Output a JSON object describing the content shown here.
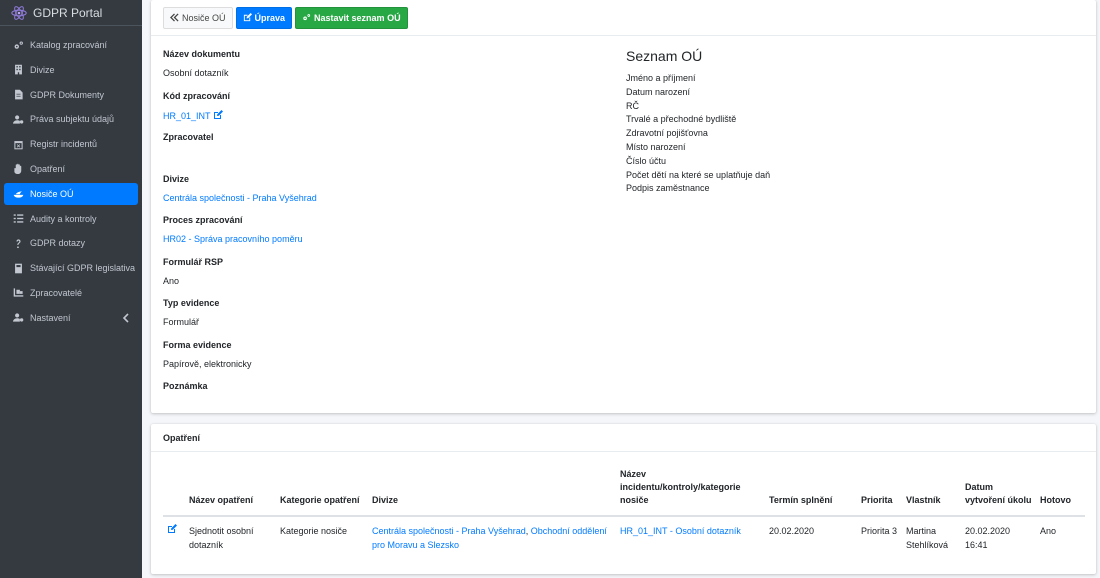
{
  "app": {
    "title": "GDPR Portal"
  },
  "sidebar": {
    "items": [
      {
        "label": "Katalog zpracování",
        "icon": "cogs-icon"
      },
      {
        "label": "Divize",
        "icon": "building-icon"
      },
      {
        "label": "GDPR Dokumenty",
        "icon": "file-icon"
      },
      {
        "label": "Práva subjektu údajů",
        "icon": "user-cog-icon"
      },
      {
        "label": "Registr incidentů",
        "icon": "calendar-x-icon"
      },
      {
        "label": "Opatření",
        "icon": "hand-icon"
      },
      {
        "label": "Nosiče OÚ",
        "icon": "sailboat-icon",
        "active": true
      },
      {
        "label": "Audity a kontroly",
        "icon": "tasks-icon"
      },
      {
        "label": "GDPR dotazy",
        "icon": "question-icon"
      },
      {
        "label": "Stávající GDPR legislativa",
        "icon": "book-icon"
      },
      {
        "label": "Zpracovatelé",
        "icon": "dolly-icon"
      },
      {
        "label": "Nastavení",
        "icon": "user-cog-icon",
        "has_caret": true
      }
    ]
  },
  "toolbar": {
    "back_label": "Nosiče OÚ",
    "edit_label": "Úprava",
    "set_list_label": "Nastavit seznam OÚ"
  },
  "document": {
    "fields": [
      {
        "label": "Název dokumentu",
        "value": "Osobní dotazník",
        "type": "text"
      },
      {
        "label": "Kód zpracování",
        "value": "HR_01_INT",
        "type": "link-edit"
      },
      {
        "label": "Zpracovatel",
        "value": "",
        "type": "text"
      },
      {
        "label": "Divize",
        "value": "Centrála společnosti - Praha Vyšehrad",
        "type": "link"
      },
      {
        "label": "Proces zpracování",
        "value": "HR02 - Správa pracovního poměru",
        "type": "link"
      },
      {
        "label": "Formulář RSP",
        "value": "Ano",
        "type": "text"
      },
      {
        "label": "Typ evidence",
        "value": "Formulář",
        "type": "text"
      },
      {
        "label": "Forma evidence",
        "value": "Papírově, elektronicky",
        "type": "text"
      },
      {
        "label": "Poznámka",
        "value": "",
        "type": "text"
      }
    ]
  },
  "ou_list": {
    "title": "Seznam OÚ",
    "items": [
      "Jméno a příjmení",
      "Datum narození",
      "RČ",
      "Trvalé a přechodné bydliště",
      "Zdravotní pojišťovna",
      "Místo narození",
      "Číslo účtu",
      "Počet dětí na které se uplatňuje daň",
      "Podpis zaměstnance"
    ]
  },
  "measures": {
    "title": "Opatření",
    "columns": [
      "",
      "Název opatření",
      "Kategorie opatření",
      "Divize",
      "Název incidentu/kontroly/kategorie nosiče",
      "Termín splnění",
      "Priorita",
      "Vlastník",
      "Datum vytvoření úkolu",
      "Hotovo"
    ],
    "rows": [
      {
        "name": "Sjednotit osobní dotazník",
        "category": "Kategorie nosiče",
        "division_1": "Centrála společnosti - Praha Vyšehrad",
        "division_sep": ", ",
        "division_2": "Obchodní oddělení pro Moravu a Slezsko",
        "incident": "HR_01_INT - Osobní dotazník",
        "deadline": "20.02.2020",
        "priority": "Priorita 3",
        "owner": "Martina Stehlíková",
        "created": "20.02.2020 16:41",
        "done": "Ano"
      }
    ]
  },
  "colors": {
    "sidebar_bg": "#343a40",
    "primary": "#007bff",
    "success": "#28a745"
  }
}
